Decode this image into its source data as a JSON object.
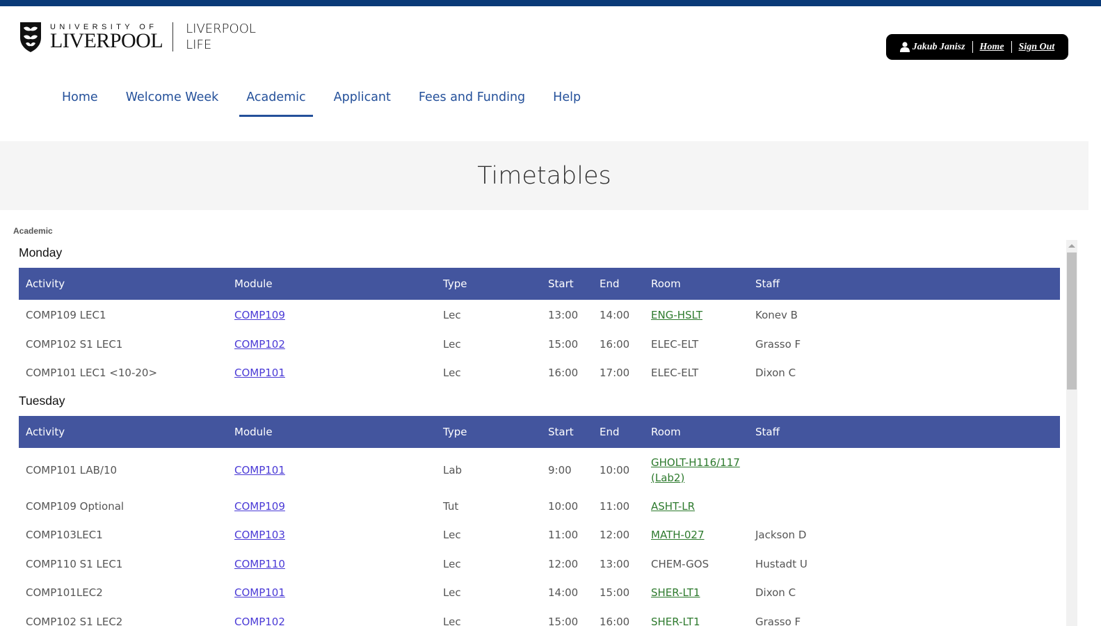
{
  "header": {
    "logo_small": "UNIVERSITY OF",
    "logo_big": "LIVERPOOL",
    "life_line1": "LIVERPOOL",
    "life_line2": "LIFE"
  },
  "user": {
    "name": "Jakub Janisz",
    "home_link": "Home",
    "signout_link": "Sign Out"
  },
  "nav": [
    {
      "label": "Home"
    },
    {
      "label": "Welcome Week"
    },
    {
      "label": "Academic"
    },
    {
      "label": "Applicant"
    },
    {
      "label": "Fees and Funding"
    },
    {
      "label": "Help"
    }
  ],
  "page_title": "Timetables",
  "breadcrumb": "Academic",
  "columns": [
    "Activity",
    "Module",
    "Type",
    "Start",
    "End",
    "Room",
    "Staff"
  ],
  "days": [
    {
      "name": "Monday",
      "rows": [
        {
          "activity": "COMP109 LEC1",
          "module": "COMP109",
          "type": "Lec",
          "start": "13:00",
          "end": "14:00",
          "room": "ENG-HSLT",
          "room_link": true,
          "staff": "Konev B"
        },
        {
          "activity": "COMP102 S1 LEC1",
          "module": "COMP102",
          "type": "Lec",
          "start": "15:00",
          "end": "16:00",
          "room": "ELEC-ELT",
          "room_link": false,
          "staff": "Grasso F"
        },
        {
          "activity": "COMP101 LEC1 <10-20>",
          "module": "COMP101",
          "type": "Lec",
          "start": "16:00",
          "end": "17:00",
          "room": "ELEC-ELT",
          "room_link": false,
          "staff": "Dixon C"
        }
      ]
    },
    {
      "name": "Tuesday",
      "rows": [
        {
          "activity": "COMP101 LAB/10",
          "module": "COMP101",
          "type": "Lab",
          "start": "9:00",
          "end": "10:00",
          "room": "GHOLT-H116/117 (Lab2)",
          "room_link": true,
          "staff": ""
        },
        {
          "activity": "COMP109 Optional",
          "module": "COMP109",
          "type": "Tut",
          "start": "10:00",
          "end": "11:00",
          "room": "ASHT-LR",
          "room_link": true,
          "staff": ""
        },
        {
          "activity": "COMP103LEC1",
          "module": "COMP103",
          "type": "Lec",
          "start": "11:00",
          "end": "12:00",
          "room": "MATH-027",
          "room_link": true,
          "staff": "Jackson D"
        },
        {
          "activity": "COMP110 S1 LEC1",
          "module": "COMP110",
          "type": "Lec",
          "start": "12:00",
          "end": "13:00",
          "room": "CHEM-GOS",
          "room_link": false,
          "staff": "Hustadt U"
        },
        {
          "activity": "COMP101LEC2",
          "module": "COMP101",
          "type": "Lec",
          "start": "14:00",
          "end": "15:00",
          "room": "SHER-LT1",
          "room_link": true,
          "staff": "Dixon C"
        },
        {
          "activity": "COMP102 S1 LEC2",
          "module": "COMP102",
          "type": "Lec",
          "start": "15:00",
          "end": "16:00",
          "room": "SHER-LT1",
          "room_link": true,
          "staff": "Grasso F"
        }
      ]
    }
  ],
  "colors": {
    "topbar": "#0a3a78",
    "nav_text": "#24509a",
    "table_header": "#43559e",
    "module_link": "#4a3ad6",
    "room_link": "#2d7a2d"
  }
}
